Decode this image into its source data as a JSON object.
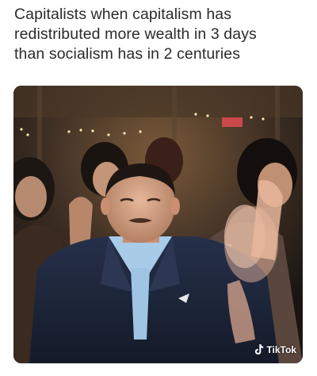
{
  "meme": {
    "caption_lines": [
      "Capitalists when capitalism has",
      "redistributed more wealth in 3 days",
      "than socialism has in 2 centuries"
    ]
  },
  "video": {
    "watermark": {
      "icon": "tiktok-icon",
      "label": "TikTok"
    }
  },
  "colors": {
    "caption_text": "#2b2b2b",
    "background": "#ffffff",
    "suit": "#1c2233",
    "shirt": "#9fc4e4",
    "ambient": "#2a221c"
  }
}
